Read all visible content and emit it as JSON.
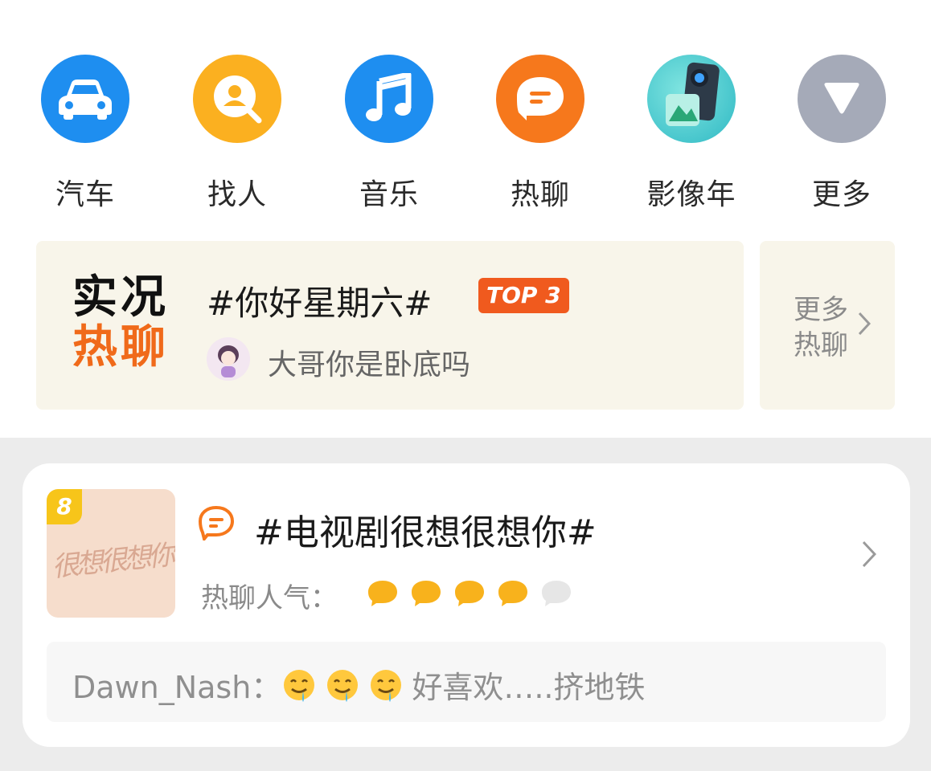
{
  "shortcuts": [
    {
      "label": "汽车",
      "icon": "car-icon",
      "color": "#1e8ef0"
    },
    {
      "label": "找人",
      "icon": "find-person-icon",
      "color": "#fbb020"
    },
    {
      "label": "音乐",
      "icon": "music-note-icon",
      "color": "#1e8ef0"
    },
    {
      "label": "热聊",
      "icon": "chat-bubble-icon",
      "color": "#f6781c"
    },
    {
      "label": "影像年",
      "icon": "camera-icon",
      "color": "#3ec7c8"
    },
    {
      "label": "更多",
      "icon": "triangle-down-icon",
      "color": "#a5aab8"
    }
  ],
  "live_chat": {
    "logo_line1": "实况",
    "logo_line2": "热聊",
    "topic": "#你好星期六#",
    "badge": "TOP 3",
    "message": "大哥你是卧底吗",
    "more_label": "更多热聊"
  },
  "topic_card": {
    "rank": "8",
    "cover_text": "很想很想你",
    "title": "#电视剧很想很想你#",
    "popularity_label": "热聊人气：",
    "popularity_level": 4,
    "popularity_max": 5,
    "comment_user": "Dawn_Nash：",
    "comment_text": "好喜欢…..挤地铁"
  }
}
